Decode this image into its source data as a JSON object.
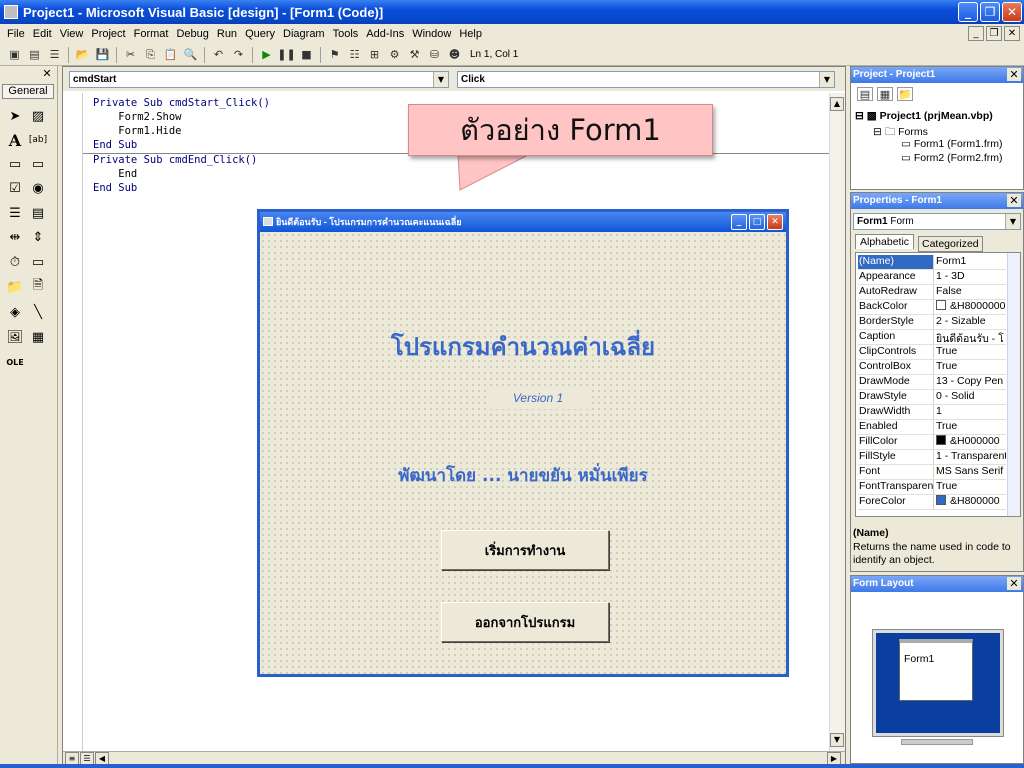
{
  "window": {
    "title": "Project1 - Microsoft Visual Basic [design] - [Form1 (Code)]",
    "buttons": {
      "minimize": "_",
      "restore": "❐",
      "close": "✕"
    }
  },
  "menu": [
    "File",
    "Edit",
    "View",
    "Project",
    "Format",
    "Debug",
    "Run",
    "Query",
    "Diagram",
    "Tools",
    "Add-Ins",
    "Window",
    "Help"
  ],
  "toolbar": {
    "position": "Ln 1, Col 1"
  },
  "toolbox": {
    "tab": "General",
    "close": "✕"
  },
  "code": {
    "object_combo": "cmdStart",
    "proc_combo": "Click",
    "lines": [
      "Private Sub cmdStart_Click()",
      "    Form2.Show",
      "    Form1.Hide",
      "End Sub",
      "Private Sub cmdEnd_Click()",
      "    End",
      "End Sub"
    ]
  },
  "callout": {
    "text": "ตัวอย่าง Form1"
  },
  "form": {
    "title": "ยินดีต้อนรับ - โปรแกรมการคำนวณคะแนนเฉลี่ย",
    "heading": "โปรแกรมคำนวณค่าเฉลี่ย",
    "version": "Version 1",
    "author": "พัฒนาโดย ... นายขยัน หมั่นเพียร",
    "start_button": "เริ่มการทำงาน",
    "exit_button": "ออกจากโปรแกรม"
  },
  "project_panel": {
    "title": "Project - Project1",
    "root": "Project1 (prjMean.vbp)",
    "folder": "Forms",
    "items": [
      "Form1 (Form1.frm)",
      "Form2 (Form2.frm)"
    ]
  },
  "properties_panel": {
    "title": "Properties - Form1",
    "object_bold": "Form1",
    "object_type": "Form",
    "tabs": [
      "Alphabetic",
      "Categorized"
    ],
    "rows": [
      {
        "name": "(Name)",
        "value": "Form1"
      },
      {
        "name": "Appearance",
        "value": "1 - 3D"
      },
      {
        "name": "AutoRedraw",
        "value": "False"
      },
      {
        "name": "BackColor",
        "value": "&H8000000"
      },
      {
        "name": "BorderStyle",
        "value": "2 - Sizable"
      },
      {
        "name": "Caption",
        "value": "ยินดีต้อนรับ - โ"
      },
      {
        "name": "ClipControls",
        "value": "True"
      },
      {
        "name": "ControlBox",
        "value": "True"
      },
      {
        "name": "DrawMode",
        "value": "13 - Copy Pen"
      },
      {
        "name": "DrawStyle",
        "value": "0 - Solid"
      },
      {
        "name": "DrawWidth",
        "value": "1"
      },
      {
        "name": "Enabled",
        "value": "True"
      },
      {
        "name": "FillColor",
        "value": "&H000000"
      },
      {
        "name": "FillStyle",
        "value": "1 - Transparent"
      },
      {
        "name": "Font",
        "value": "MS Sans Serif"
      },
      {
        "name": "FontTransparent",
        "value": "True"
      },
      {
        "name": "ForeColor",
        "value": "&H800000"
      }
    ],
    "desc_title": "(Name)",
    "desc_text": "Returns the name used in code to identify an object."
  },
  "layout_panel": {
    "title": "Form Layout",
    "form_label": "Form1"
  },
  "colors": {
    "accent": "#316ac5",
    "heading": "#3a68c8",
    "callout": "#ffc5c5",
    "titlebar": "#0a4ed8"
  }
}
